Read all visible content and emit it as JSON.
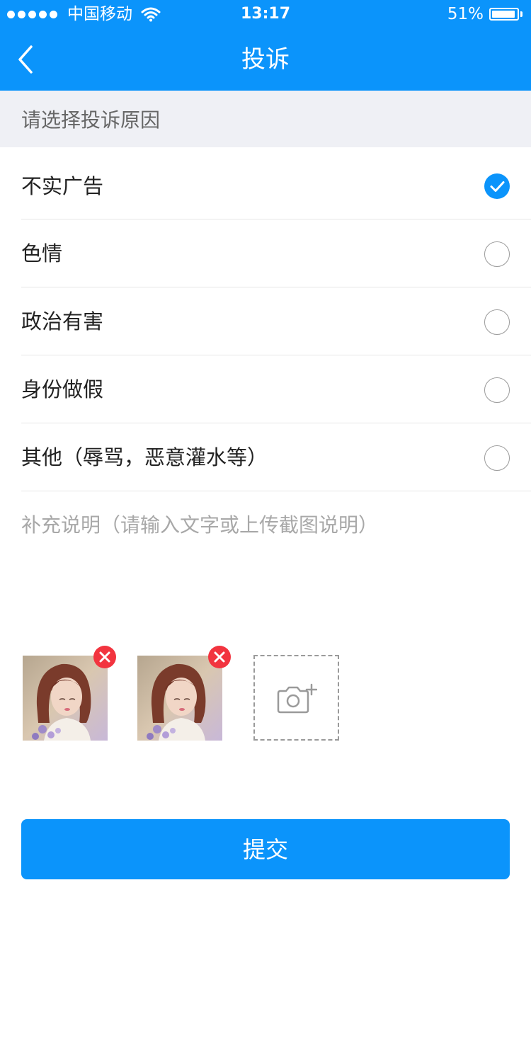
{
  "status_bar": {
    "carrier": "中国移动",
    "time": "13:17",
    "battery": "51%",
    "battery_level": 0.51
  },
  "nav": {
    "title": "投诉",
    "back_icon": "chevron-left-icon"
  },
  "section_header": "请选择投诉原因",
  "options": [
    {
      "label": "不实广告",
      "selected": true
    },
    {
      "label": "色情",
      "selected": false
    },
    {
      "label": "政治有害",
      "selected": false
    },
    {
      "label": "身份做假",
      "selected": false
    },
    {
      "label": "其他（辱骂，恶意灌水等）",
      "selected": false
    }
  ],
  "note_placeholder": "补充说明（请输入文字或上传截图说明）",
  "attachments": {
    "photo_count": 2,
    "remove_icon": "close-icon",
    "add_icon": "camera-add-icon"
  },
  "submit_label": "提交",
  "colors": {
    "primary": "#0b94fb",
    "header_bg": "#eff0f5",
    "danger": "#f2343f"
  }
}
